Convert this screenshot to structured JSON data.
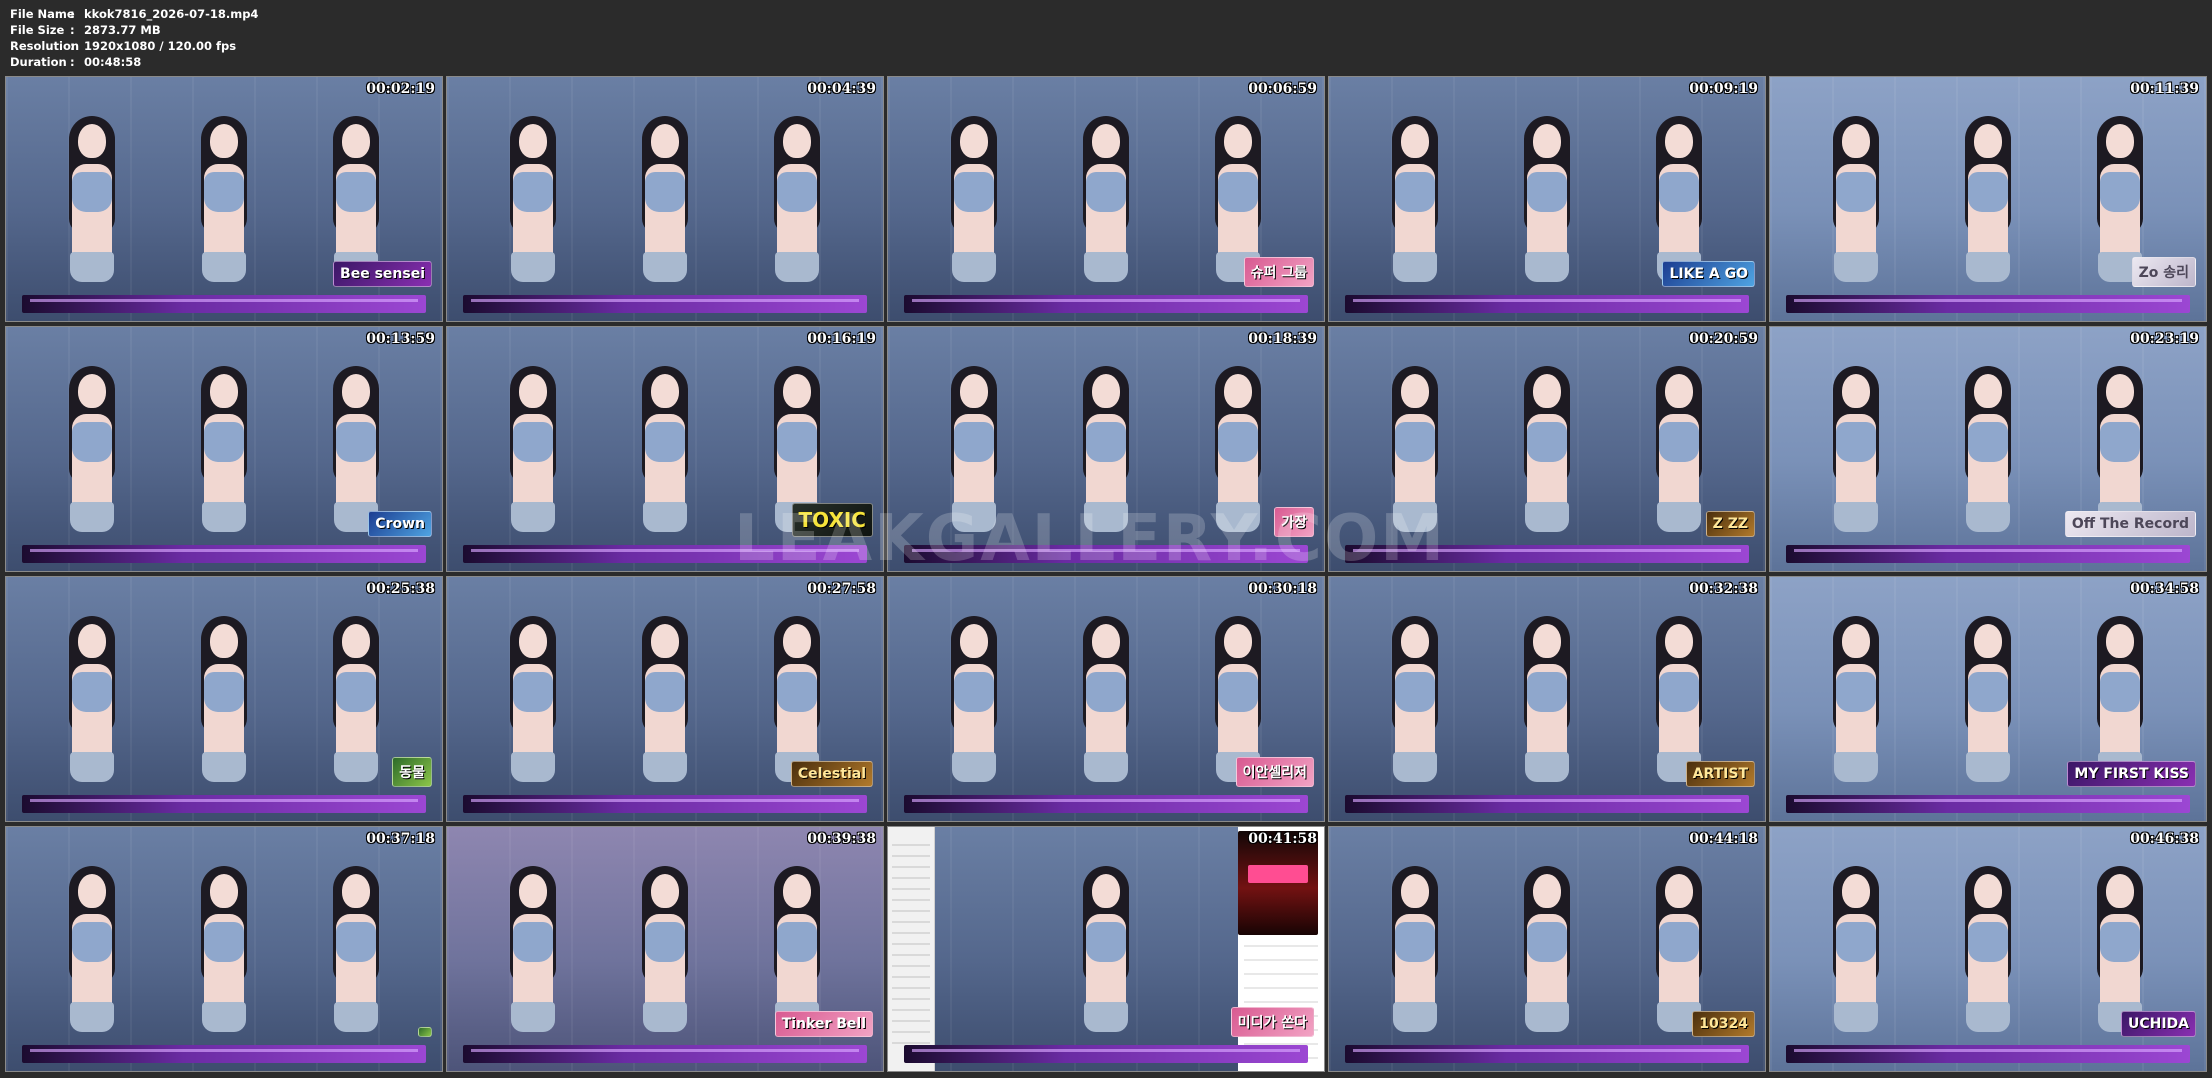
{
  "file_info": [
    {
      "label": "File Name",
      "separator": ":",
      "value": "kkok7816_2026-07-18.mp4"
    },
    {
      "label": "File Size",
      "separator": ":",
      "value": "2873.77 MB"
    },
    {
      "label": "Resolution",
      "separator": ":",
      "value": "1920x1080 / 120.00 fps"
    },
    {
      "label": "Duration",
      "separator": ":",
      "value": "00:48:58"
    }
  ],
  "frames": [
    {
      "time": "00:02:19",
      "badge": "Bee sensei",
      "badge_style": "default"
    },
    {
      "time": "00:04:39",
      "badge": "",
      "badge_style": "default"
    },
    {
      "time": "00:06:59",
      "badge": "슈퍼 그룹",
      "badge_style": "pinkish"
    },
    {
      "time": "00:09:19",
      "badge": "LIKE A GO",
      "badge_style": "blue"
    },
    {
      "time": "00:11:39",
      "badge": "Zo 송리",
      "badge_style": "white"
    },
    {
      "time": "00:13:59",
      "badge": "Crown",
      "badge_style": "blue"
    },
    {
      "time": "00:16:19",
      "badge": "TOXIC",
      "badge_style": "yellow"
    },
    {
      "time": "00:18:39",
      "badge": "가장",
      "badge_style": "pinkish"
    },
    {
      "time": "00:20:59",
      "badge": "Z ZZ",
      "badge_style": "gold"
    },
    {
      "time": "00:23:19",
      "badge": "Off The Record",
      "badge_style": "white"
    },
    {
      "time": "00:25:38",
      "badge": "동물",
      "badge_style": "green"
    },
    {
      "time": "00:27:58",
      "badge": "Celestial",
      "badge_style": "gold"
    },
    {
      "time": "00:30:18",
      "badge": "이안셀리저",
      "badge_style": "pinkish"
    },
    {
      "time": "00:32:38",
      "badge": "ARTIST",
      "badge_style": "gold"
    },
    {
      "time": "00:34:58",
      "badge": "MY FIRST KISS",
      "badge_style": "default"
    },
    {
      "time": "00:37:18",
      "badge": "",
      "badge_style": "green"
    },
    {
      "time": "00:39:38",
      "badge": "Tinker Bell",
      "badge_style": "pinkish"
    },
    {
      "time": "00:41:58",
      "badge": "미디가 쏜다",
      "badge_style": "pinkish"
    },
    {
      "time": "00:44:18",
      "badge": "10324",
      "badge_style": "gold"
    },
    {
      "time": "00:46:38",
      "badge": "UCHIDA",
      "badge_style": "default"
    }
  ],
  "watermark": "LEAKGALLERY.COM"
}
